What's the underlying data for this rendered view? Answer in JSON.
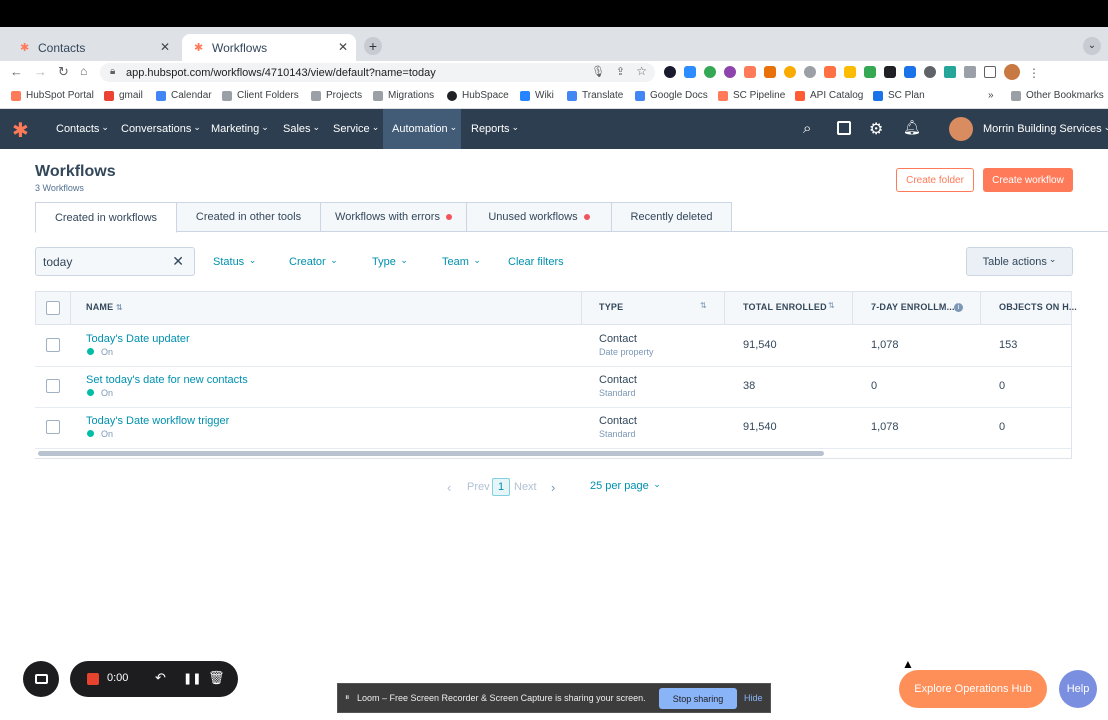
{
  "browser": {
    "tabs": [
      {
        "label": "Contacts",
        "active": false
      },
      {
        "label": "Workflows",
        "active": true
      }
    ],
    "url": "app.hubspot.com/workflows/4710143/view/default?name=today",
    "bookmarks": [
      "HubSpot Portal",
      "gmail",
      "Calendar",
      "Client Folders",
      "Projects",
      "Migrations",
      "HubSpace",
      "Wiki",
      "Translate",
      "Google Docs",
      "SC Pipeline",
      "API Catalog",
      "SC Plan"
    ],
    "bookmarks_more": "»",
    "other_bookmarks": "Other Bookmarks"
  },
  "nav": {
    "items": [
      "Contacts",
      "Conversations",
      "Marketing",
      "Sales",
      "Service",
      "Automation",
      "Reports"
    ],
    "active": "Automation",
    "account": "Morrin Building Services"
  },
  "page": {
    "title": "Workflows",
    "subtitle": "3 Workflows",
    "create_folder": "Create folder",
    "create_workflow": "Create workflow"
  },
  "tabs": [
    {
      "label": "Created in workflows",
      "active": true,
      "dot": false
    },
    {
      "label": "Created in other tools",
      "active": false,
      "dot": false
    },
    {
      "label": "Workflows with errors",
      "active": false,
      "dot": true
    },
    {
      "label": "Unused workflows",
      "active": false,
      "dot": true
    },
    {
      "label": "Recently deleted",
      "active": false,
      "dot": false
    }
  ],
  "search": {
    "value": "today"
  },
  "filters": [
    "Status",
    "Creator",
    "Type",
    "Team"
  ],
  "clear_filters": "Clear filters",
  "table_actions": "Table actions",
  "table": {
    "headers": [
      "NAME",
      "TYPE",
      "TOTAL ENROLLED",
      "7-DAY ENROLLM...",
      "OBJECTS ON H..."
    ],
    "rows": [
      {
        "name": "Today's Date updater",
        "status": "On",
        "type": "Contact",
        "subtype": "Date property",
        "total": "91,540",
        "seven_day": "1,078",
        "objects": "153"
      },
      {
        "name": "Set today's date for new contacts",
        "status": "On",
        "type": "Contact",
        "subtype": "Standard",
        "total": "38",
        "seven_day": "0",
        "objects": "0"
      },
      {
        "name": "Today's Date workflow trigger",
        "status": "On",
        "type": "Contact",
        "subtype": "Standard",
        "total": "91,540",
        "seven_day": "1,078",
        "objects": "0"
      }
    ]
  },
  "pagination": {
    "prev": "Prev",
    "page": "1",
    "next": "Next",
    "per_page": "25 per page"
  },
  "recorder": {
    "time": "0:00"
  },
  "share_bar": {
    "message": "Loom – Free Screen Recorder & Screen Capture is sharing your screen.",
    "stop": "Stop sharing",
    "hide": "Hide"
  },
  "explore": "Explore Operations Hub",
  "help": "Help",
  "colors": {
    "nav_bg": "#2d3e50",
    "accent": "#ff7a59",
    "link": "#0091ae",
    "status_on": "#00bda5"
  }
}
